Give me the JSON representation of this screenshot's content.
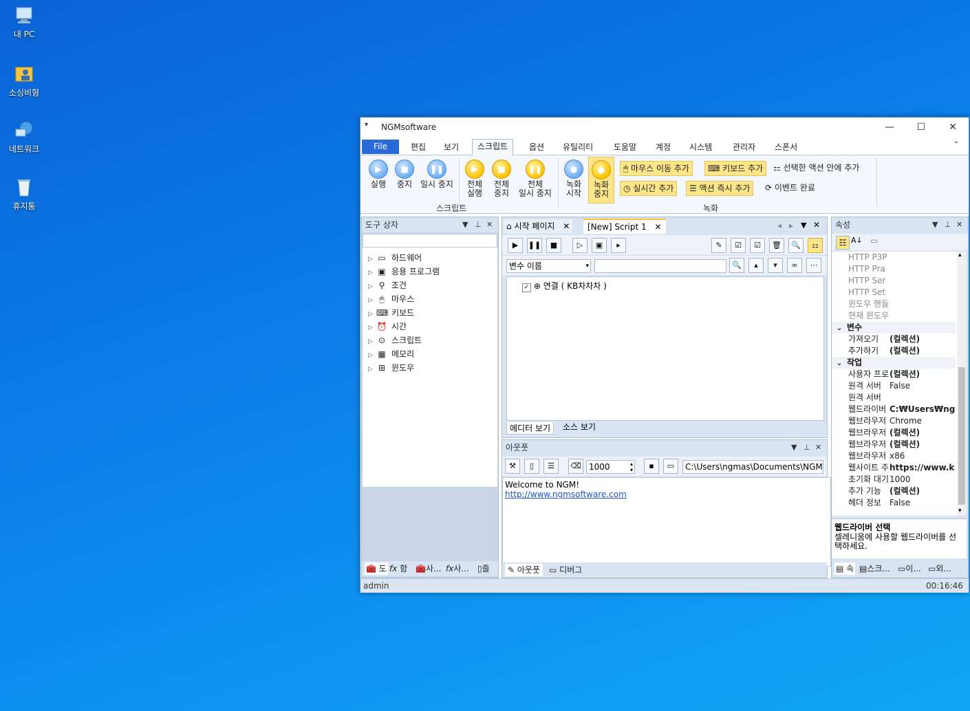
{
  "desktop": {
    "icons": [
      {
        "label": "내 PC"
      },
      {
        "label": "소싱비형"
      },
      {
        "label": "네트워크"
      },
      {
        "label": "휴지통"
      }
    ]
  },
  "window": {
    "title": "NGMsoftware",
    "menu": [
      "File",
      "편집",
      "보기",
      "스크립트",
      "옵션",
      "유틸리티",
      "도움말",
      "계정",
      "시스템",
      "관리자",
      "스폰서"
    ],
    "active_menu": "스크립트"
  },
  "ribbon": {
    "run": {
      "run": "실행",
      "stop": "중지",
      "pause": "일시 중지"
    },
    "all": {
      "run_1": "전체",
      "run_2": "실행",
      "stop_1": "전체",
      "stop_2": "중지",
      "pause_1": "전체",
      "pause_2": "일시 중지"
    },
    "record": {
      "start_1": "녹화",
      "start_2": "시작",
      "stop_1": "녹화",
      "stop_2": "중지"
    },
    "actions": {
      "mouse": "마우스 이동 추가",
      "keyboard": "키보드 추가",
      "into_selected": "선택한 액션 안에 추가",
      "realtime": "실시간 추가",
      "instant": "액션 즉시 추가",
      "event_done": "이벤트 완료"
    },
    "group_script": "스크립트",
    "group_record": "녹화"
  },
  "toolbox": {
    "title": "도구 상자",
    "items": [
      "하드웨어",
      "응용 프로그램",
      "조건",
      "마우스",
      "키보드",
      "시간",
      "스크립트",
      "메모리",
      "윈도우"
    ],
    "bottom_tabs": [
      "도",
      "함",
      "사...",
      "사...",
      "즐"
    ]
  },
  "editor": {
    "tabs": [
      "시작 페이지",
      "[New] Script 1"
    ],
    "var_select": "변수 이름",
    "tree_item": "연결 ( KB차차차 )",
    "view_tabs": [
      "에디터 보기",
      "소스 보기"
    ]
  },
  "output": {
    "title": "아웃풋",
    "count": "1000",
    "path": "C:\\Users\\ngmas\\Documents\\NGM6\\",
    "line1": "Welcome to NGM!",
    "link": "http://www.ngmsoftware.com",
    "bottom_tabs": [
      "아웃풋",
      "디버그"
    ]
  },
  "properties": {
    "title": "속성",
    "rows_top": [
      "HTTP P3P",
      "HTTP Pra",
      "HTTP Ser",
      "HTTP Set",
      "윈도우 핸들",
      "현재 윈도우"
    ],
    "cat_var": "변수",
    "var_rows": [
      {
        "k": "가져오기",
        "v": "(컬렉션)"
      },
      {
        "k": "추가하기",
        "v": "(컬렉션)"
      }
    ],
    "cat_work": "작업",
    "work_rows": [
      {
        "k": "사용자 프로",
        "v": "(컬렉션)",
        "b": true
      },
      {
        "k": "원격 서버",
        "v": "False",
        "b": false
      },
      {
        "k": "원격 서버",
        "v": "",
        "b": false
      },
      {
        "k": "웹드라이버",
        "v": "C:₩Users₩ngm",
        "b": true
      },
      {
        "k": "웹브라우저",
        "v": "Chrome",
        "b": false
      },
      {
        "k": "웹브라우저",
        "v": "(컬렉션)",
        "b": true
      },
      {
        "k": "웹브라우저",
        "v": "(컬렉션)",
        "b": true
      },
      {
        "k": "웹브라우저",
        "v": "x86",
        "b": false
      },
      {
        "k": "웹사이트 주",
        "v": "https://www.k",
        "b": true
      },
      {
        "k": "초기화 대기",
        "v": "1000",
        "b": false
      },
      {
        "k": "추가 기능",
        "v": "(컬렉션)",
        "b": true
      },
      {
        "k": "헤더 정보",
        "v": "False",
        "b": false
      }
    ],
    "desc_title": "웹드라이버 선택",
    "desc_text": "셀레니움에 사용할 웹드라이버를 선택하세요.",
    "bottom_tabs": [
      "속",
      "스크...",
      "이...",
      "외..."
    ]
  },
  "status": {
    "user": "admin",
    "time": "00:16:46"
  }
}
